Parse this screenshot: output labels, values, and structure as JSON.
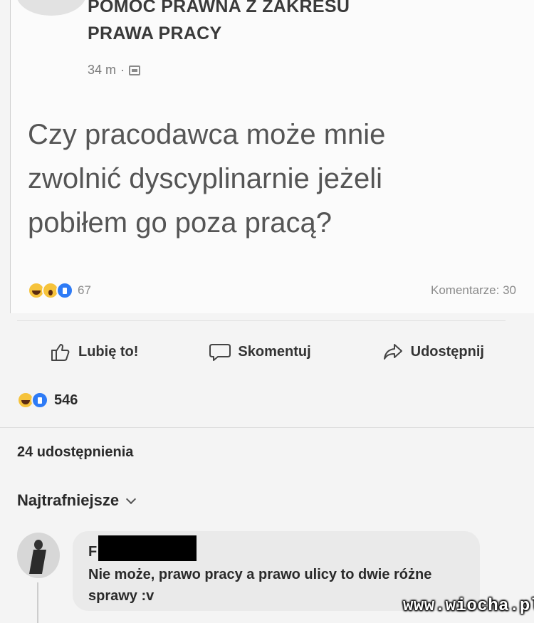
{
  "shared_post": {
    "group_title_line1": "POMOC PRAWNA Z ZAKRESU",
    "group_title_line2": "PRAWA PRACY",
    "time": "34 m",
    "separator": "·",
    "question": "Czy pracodawca może mnie\nzwolnić dyscyplinarnie jeżeli\npobiłem go poza pracą?",
    "reaction_count": "67",
    "comments_label": "Komentarze: 30"
  },
  "actions": {
    "like": "Lubię to!",
    "comment": "Skomentuj",
    "share": "Udostępnij"
  },
  "reactions": {
    "count": "546"
  },
  "shares": "24 udostępnienia",
  "sort": {
    "label": "Najtrafniejsze"
  },
  "comment": {
    "author_initial": "F",
    "text": "Nie może, prawo pracy a prawo ulicy to dwie różne sprawy :v"
  },
  "watermark": "www.wiocha.pl",
  "colors": {
    "like_blue": "#2e7bf6",
    "emoji_yellow": "#f6c33b",
    "bubble_gray": "#eaeaea"
  }
}
